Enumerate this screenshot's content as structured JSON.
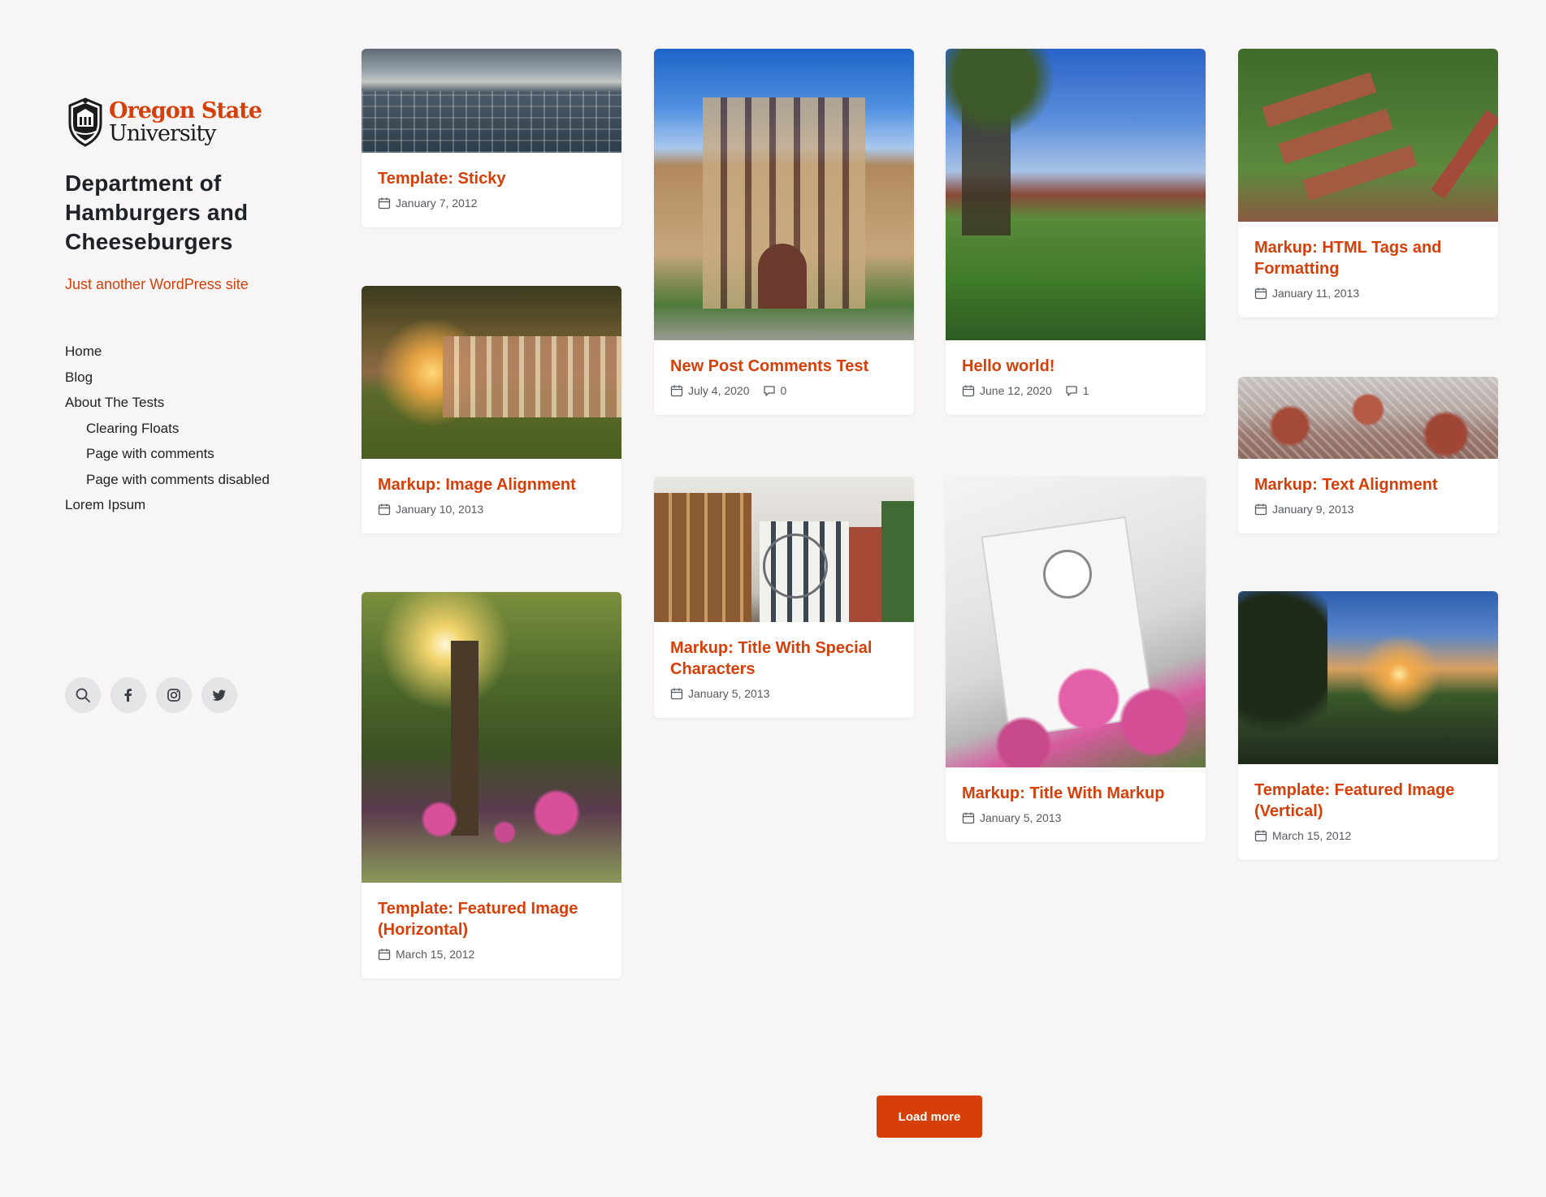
{
  "brand": {
    "logo_line1": "Oregon State",
    "logo_line2": "University",
    "accent_color": "#d73f09"
  },
  "site": {
    "title": "Department of Hamburgers and Cheeseburgers",
    "description": "Just another WordPress site"
  },
  "nav": {
    "items": [
      {
        "label": "Home"
      },
      {
        "label": "Blog"
      },
      {
        "label": "About The Tests"
      },
      {
        "label": "Clearing Floats"
      },
      {
        "label": "Page with comments"
      },
      {
        "label": "Page with comments disabled"
      },
      {
        "label": "Lorem Ipsum"
      }
    ]
  },
  "socials": [
    "search-icon",
    "facebook-icon",
    "instagram-icon",
    "twitter-icon"
  ],
  "posts": [
    {
      "title": "Template: Sticky",
      "date": "January 7, 2012"
    },
    {
      "title": "Markup: Image Alignment",
      "date": "January 10, 2013"
    },
    {
      "title": "Template: Featured Image (Horizontal)",
      "date": "March 15, 2012"
    },
    {
      "title": "New Post Comments Test",
      "date": "July 4, 2020",
      "comments": "0"
    },
    {
      "title": "Markup: Title With Special Characters",
      "date": "January 5, 2013"
    },
    {
      "title": "Hello world!",
      "date": "June 12, 2020",
      "comments": "1"
    },
    {
      "title": "Markup: Title With Markup",
      "date": "January 5, 2013"
    },
    {
      "title": "Markup: HTML Tags and Formatting",
      "date": "January 11, 2013"
    },
    {
      "title": "Markup: Text Alignment",
      "date": "January 9, 2013"
    },
    {
      "title": "Template: Featured Image (Vertical)",
      "date": "March 15, 2012"
    }
  ],
  "load_more": "Load more"
}
